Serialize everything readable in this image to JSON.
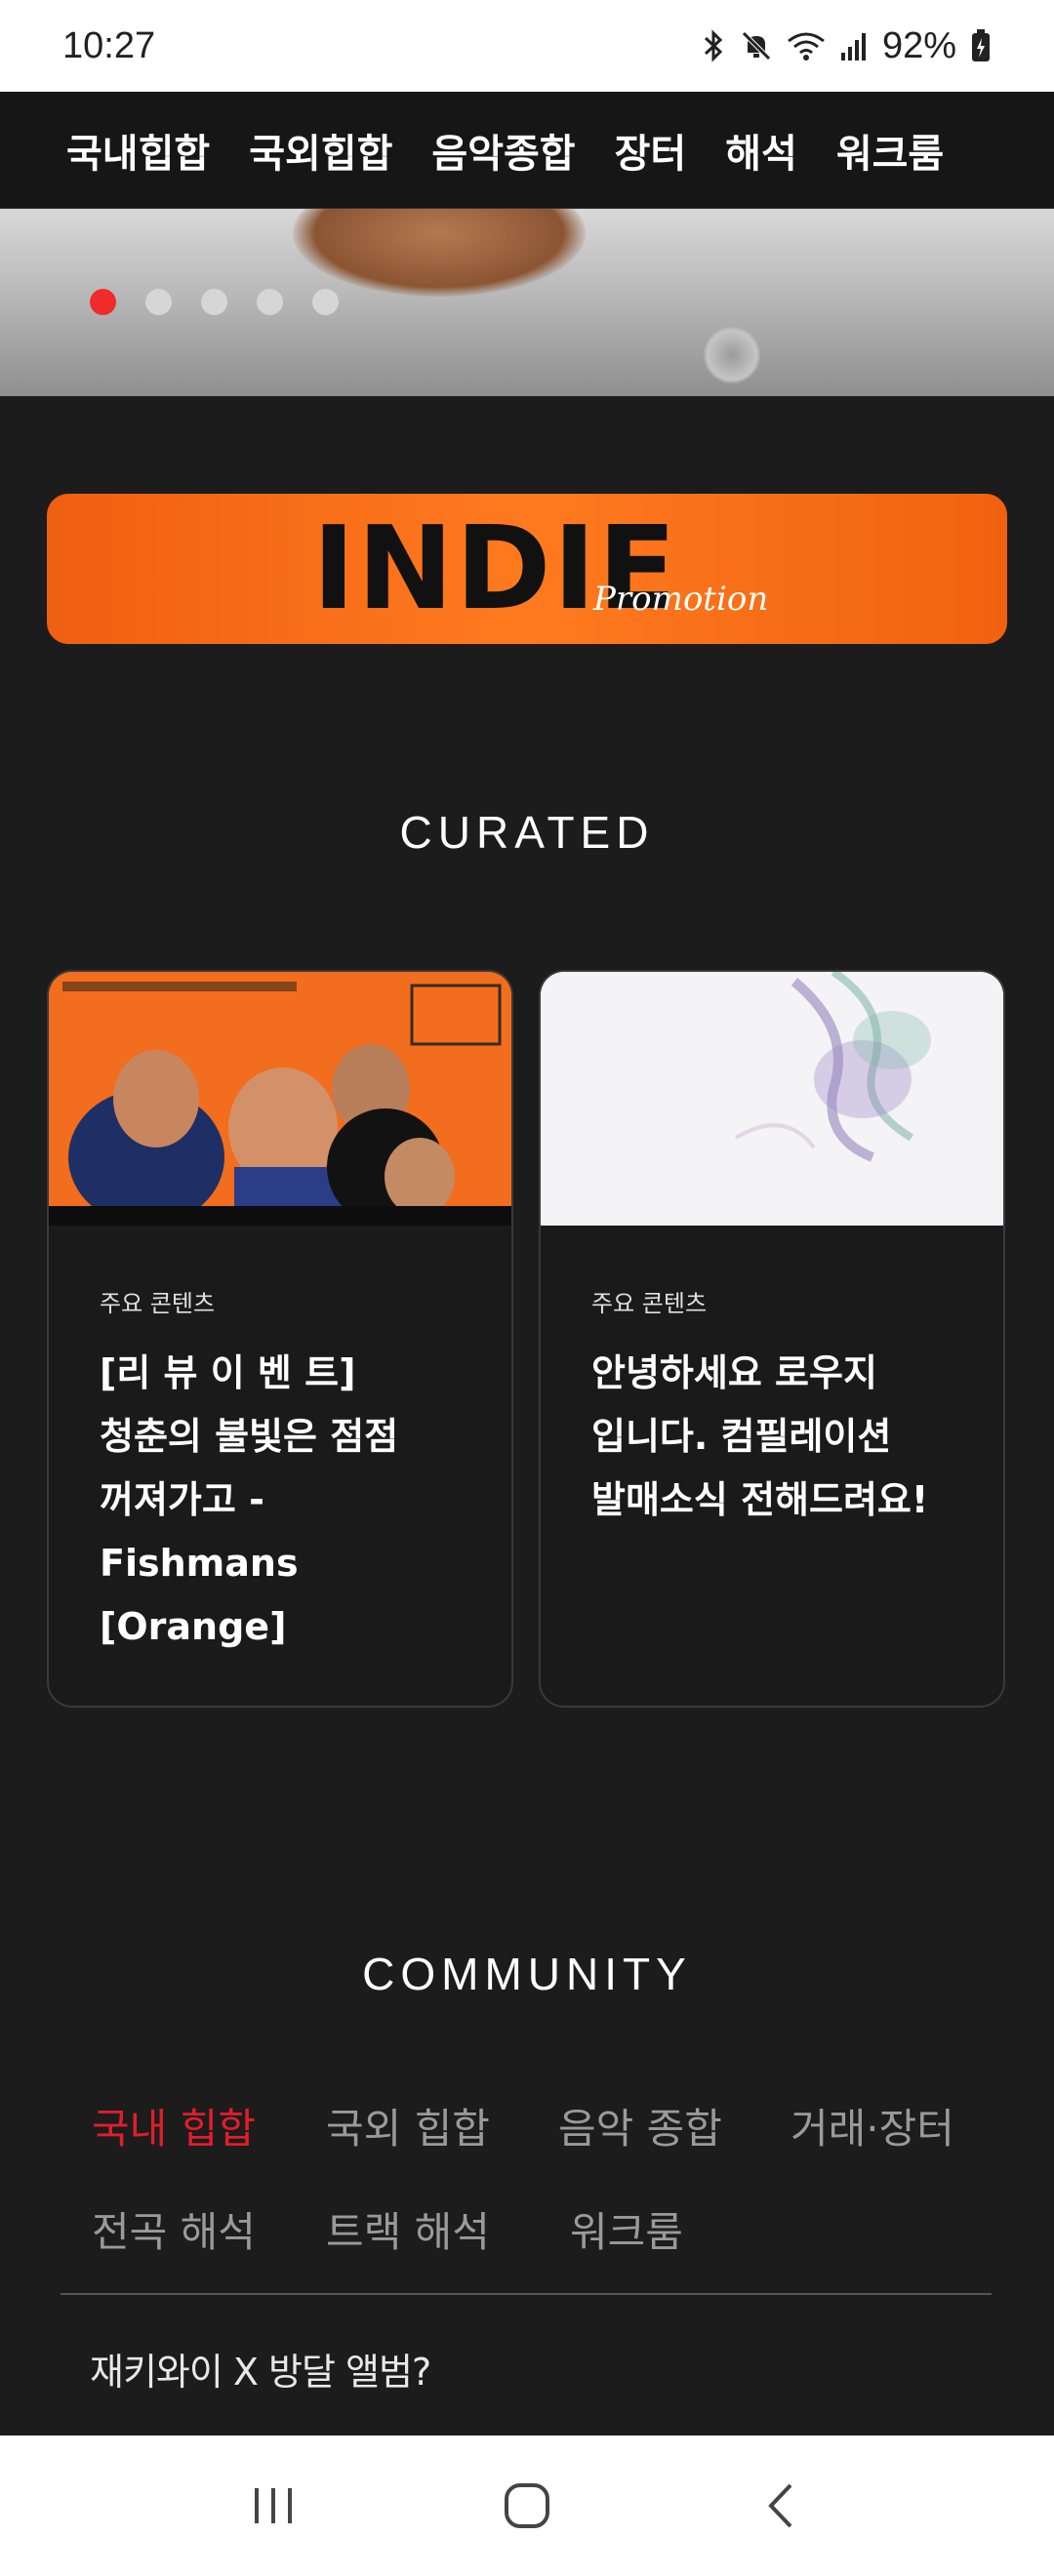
{
  "status_bar": {
    "time": "10:27",
    "battery": "92%",
    "icons": [
      "bluetooth-icon",
      "mute-icon",
      "wifi-icon",
      "signal-icon",
      "battery-charging-icon"
    ]
  },
  "nav": {
    "items": [
      "국내힙합",
      "국외힙합",
      "음악종합",
      "장터",
      "해석",
      "워크룸"
    ]
  },
  "hero": {
    "slide_count": 5,
    "active_slide": 1,
    "accent_color": "#f02b2b"
  },
  "banner": {
    "title": "INDIE",
    "subtitle": "Promotion",
    "color": "#ff6f1a"
  },
  "curated": {
    "title": "CURATED",
    "cards": [
      {
        "label": "주요 콘텐츠",
        "title_lines": [
          "[리 뷰 이 벤 트]",
          "청춘의 불빛은 점점",
          "꺼져가고 -",
          "Fishmans",
          "[Orange]"
        ],
        "image": "fishmans-orange-album-cover"
      },
      {
        "label": "주요 콘텐츠",
        "title_lines": [
          "안녕하세요 로우지",
          "입니다. 컴필레이션",
          "발매소식 전해드려요!"
        ],
        "image": "abstract-smoke-artwork"
      }
    ]
  },
  "community": {
    "title": "COMMUNITY",
    "tabs": [
      "국내 힙합",
      "국외 힙합",
      "음악 종합",
      "거래·장터",
      "전곡 해석",
      "트랙 해석",
      "워크룸"
    ],
    "active_tab": 0,
    "active_color": "#e01e2a",
    "posts": [
      "재키와이 X 방달 앨범?"
    ]
  },
  "system_nav": {
    "buttons": [
      "recent-apps-icon",
      "home-icon",
      "back-icon"
    ]
  }
}
